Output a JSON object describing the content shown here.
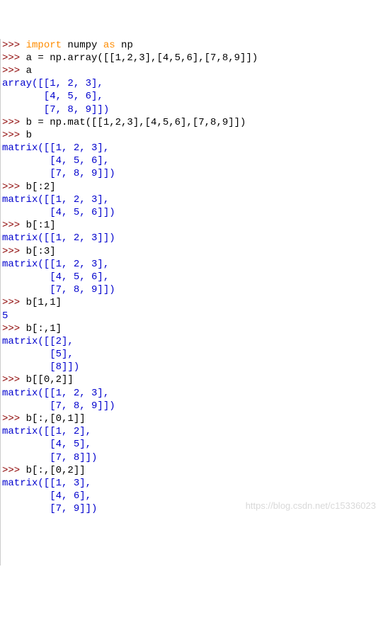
{
  "lines": [
    {
      "segs": [
        {
          "c": "prompt",
          "t": ">>> "
        },
        {
          "c": "kw",
          "t": "import"
        },
        {
          "c": "txt",
          "t": " numpy "
        },
        {
          "c": "kw",
          "t": "as"
        },
        {
          "c": "txt",
          "t": " np"
        }
      ]
    },
    {
      "segs": [
        {
          "c": "prompt",
          "t": ">>> "
        },
        {
          "c": "txt",
          "t": "a = np.array([[1,2,3],[4,5,6],[7,8,9]])"
        }
      ]
    },
    {
      "segs": [
        {
          "c": "prompt",
          "t": ">>> "
        },
        {
          "c": "txt",
          "t": "a"
        }
      ]
    },
    {
      "segs": [
        {
          "c": "out",
          "t": "array([[1, 2, 3],"
        }
      ]
    },
    {
      "segs": [
        {
          "c": "out",
          "t": "       [4, 5, 6],"
        }
      ]
    },
    {
      "segs": [
        {
          "c": "out",
          "t": "       [7, 8, 9]])"
        }
      ]
    },
    {
      "segs": [
        {
          "c": "prompt",
          "t": ">>> "
        },
        {
          "c": "txt",
          "t": "b = np.mat([[1,2,3],[4,5,6],[7,8,9]])"
        }
      ]
    },
    {
      "segs": [
        {
          "c": "prompt",
          "t": ">>> "
        },
        {
          "c": "txt",
          "t": "b"
        }
      ]
    },
    {
      "segs": [
        {
          "c": "out",
          "t": "matrix([[1, 2, 3],"
        }
      ]
    },
    {
      "segs": [
        {
          "c": "out",
          "t": "        [4, 5, 6],"
        }
      ]
    },
    {
      "segs": [
        {
          "c": "out",
          "t": "        [7, 8, 9]])"
        }
      ]
    },
    {
      "segs": [
        {
          "c": "prompt",
          "t": ">>> "
        },
        {
          "c": "txt",
          "t": "b[:2]"
        }
      ]
    },
    {
      "segs": [
        {
          "c": "out",
          "t": "matrix([[1, 2, 3],"
        }
      ]
    },
    {
      "segs": [
        {
          "c": "out",
          "t": "        [4, 5, 6]])"
        }
      ]
    },
    {
      "segs": [
        {
          "c": "prompt",
          "t": ">>> "
        },
        {
          "c": "txt",
          "t": "b[:1]"
        }
      ]
    },
    {
      "segs": [
        {
          "c": "out",
          "t": "matrix([[1, 2, 3]])"
        }
      ]
    },
    {
      "segs": [
        {
          "c": "prompt",
          "t": ">>> "
        },
        {
          "c": "txt",
          "t": "b[:3]"
        }
      ]
    },
    {
      "segs": [
        {
          "c": "out",
          "t": "matrix([[1, 2, 3],"
        }
      ]
    },
    {
      "segs": [
        {
          "c": "out",
          "t": "        [4, 5, 6],"
        }
      ]
    },
    {
      "segs": [
        {
          "c": "out",
          "t": "        [7, 8, 9]])"
        }
      ]
    },
    {
      "segs": [
        {
          "c": "prompt",
          "t": ">>> "
        },
        {
          "c": "txt",
          "t": "b[1,1]"
        }
      ]
    },
    {
      "segs": [
        {
          "c": "num",
          "t": "5"
        }
      ]
    },
    {
      "segs": [
        {
          "c": "prompt",
          "t": ">>> "
        },
        {
          "c": "txt",
          "t": "b[:,1]"
        }
      ]
    },
    {
      "segs": [
        {
          "c": "out",
          "t": "matrix([[2],"
        }
      ]
    },
    {
      "segs": [
        {
          "c": "out",
          "t": "        [5],"
        }
      ]
    },
    {
      "segs": [
        {
          "c": "out",
          "t": "        [8]])"
        }
      ]
    },
    {
      "segs": [
        {
          "c": "prompt",
          "t": ">>> "
        },
        {
          "c": "txt",
          "t": "b[[0,2]]"
        }
      ]
    },
    {
      "segs": [
        {
          "c": "out",
          "t": "matrix([[1, 2, 3],"
        }
      ]
    },
    {
      "segs": [
        {
          "c": "out",
          "t": "        [7, 8, 9]])"
        }
      ]
    },
    {
      "segs": [
        {
          "c": "prompt",
          "t": ">>> "
        },
        {
          "c": "txt",
          "t": "b[:,[0,1]]"
        }
      ]
    },
    {
      "segs": [
        {
          "c": "out",
          "t": "matrix([[1, 2],"
        }
      ]
    },
    {
      "segs": [
        {
          "c": "out",
          "t": "        [4, 5],"
        }
      ]
    },
    {
      "segs": [
        {
          "c": "out",
          "t": "        [7, 8]])"
        }
      ]
    },
    {
      "segs": [
        {
          "c": "prompt",
          "t": ">>> "
        },
        {
          "c": "txt",
          "t": "b[:,[0,2]]"
        }
      ]
    },
    {
      "segs": [
        {
          "c": "out",
          "t": "matrix([[1, 3],"
        }
      ]
    },
    {
      "segs": [
        {
          "c": "out",
          "t": "        [4, 6],"
        }
      ]
    },
    {
      "segs": [
        {
          "c": "out",
          "t": "        [7, 9]])"
        }
      ]
    }
  ],
  "watermark": "https://blog.csdn.net/c15336023"
}
